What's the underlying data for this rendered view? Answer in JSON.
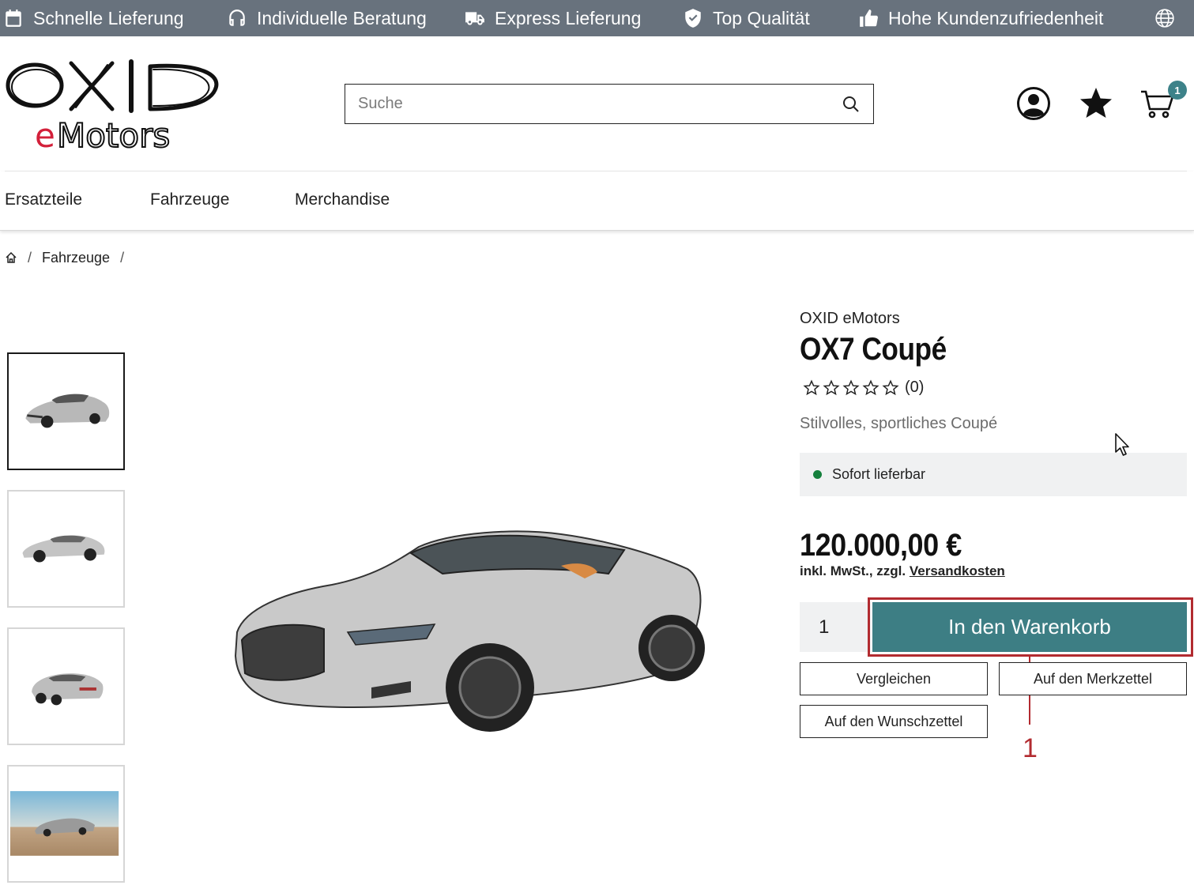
{
  "topbar": {
    "items": [
      {
        "label": "Schnelle Lieferung",
        "icon": "calendar-icon"
      },
      {
        "label": "Individuelle Beratung",
        "icon": "headset-icon"
      },
      {
        "label": "Express Lieferung",
        "icon": "truck-icon"
      },
      {
        "label": "Top Qualität",
        "icon": "shield-check-icon"
      },
      {
        "label": "Hohe Kundenzufriedenheit",
        "icon": "thumbs-up-icon"
      }
    ],
    "language_icon": "globe-icon"
  },
  "header": {
    "logo_line1": "OXID",
    "logo_line2": "eMotors",
    "search_placeholder": "Suche",
    "search_value": "",
    "cart_count": "1"
  },
  "nav": {
    "items": [
      "Ersatzteile",
      "Fahrzeuge",
      "Merchandise"
    ]
  },
  "breadcrumb": {
    "items": [
      "Fahrzeuge"
    ]
  },
  "product": {
    "brand": "OXID eMotors",
    "title": "OX7 Coupé",
    "rating_count": "(0)",
    "rating_stars": 0,
    "short_description": "Stilvolles, sportliches Coupé",
    "stock": "Sofort lieferbar",
    "price": "120.000,00 €",
    "tax_text": "inkl. MwSt., zzgl.",
    "shipping_link": "Versandkosten",
    "quantity": "1",
    "add_to_cart": "In den Warenkorb",
    "compare": "Vergleichen",
    "notice_list": "Auf den Merkzettel",
    "wish_list": "Auf den Wunschzettel",
    "thumbnails": 4
  },
  "annotation": {
    "number": "1",
    "color": "#b22b30"
  },
  "colors": {
    "topbar": "#68727d",
    "accent": "#3d7e84",
    "stock_dot": "#15803d"
  }
}
